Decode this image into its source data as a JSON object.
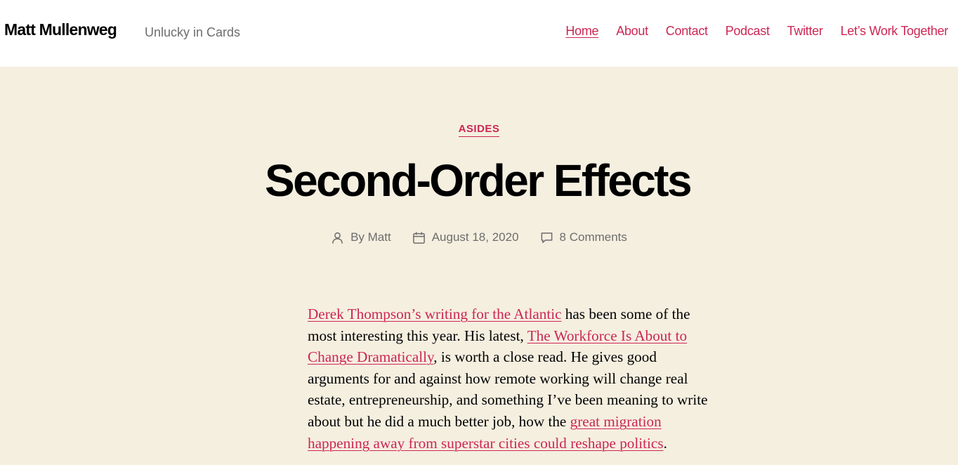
{
  "site": {
    "title": "Matt Mullenweg",
    "description": "Unlucky in Cards"
  },
  "nav": {
    "items": [
      {
        "label": "Home",
        "current": true
      },
      {
        "label": "About"
      },
      {
        "label": "Contact"
      },
      {
        "label": "Podcast"
      },
      {
        "label": "Twitter"
      },
      {
        "label": "Let’s Work Together"
      }
    ]
  },
  "post": {
    "category": "ASIDES",
    "title": "Second-Order Effects",
    "author": "By Matt",
    "date": "August 18, 2020",
    "comments": "8 Comments",
    "icons": {
      "author": "user-icon",
      "date": "calendar-icon",
      "comments": "comment-icon"
    },
    "body": {
      "link1": "Derek Thompson’s writing for the Atlantic",
      "text1": " has been some of the most interesting this year. His latest, ",
      "link2": "The Workforce Is About to Change Dramatically",
      "text2": ", is worth a close read. He gives good arguments for and against how remote working will change real estate, entrepreneurship, and something I’ve been meaning to write about but he did a much better job, how the ",
      "link3": "great migration happening away from superstar cities could reshape politics",
      "text3": "."
    }
  },
  "colors": {
    "accent": "#cd2653",
    "background": "#f5efe0",
    "header_bg": "#ffffff",
    "meta_text": "#6d6d6d"
  }
}
